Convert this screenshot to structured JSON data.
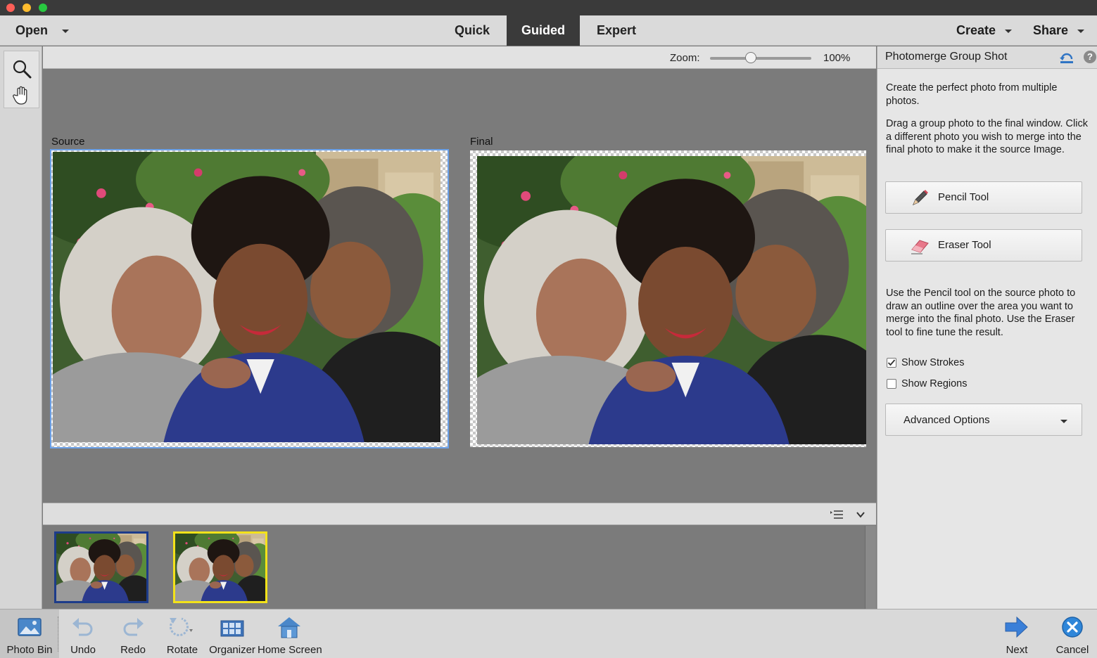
{
  "menubar": {
    "open_label": "Open",
    "modes": [
      "Quick",
      "Guided",
      "Expert"
    ],
    "active_mode": "Guided",
    "create_label": "Create",
    "share_label": "Share"
  },
  "toolbox": {
    "tools": [
      "zoom-tool",
      "hand-tool"
    ]
  },
  "options": {
    "zoom_label": "Zoom:",
    "zoom_value": "100%",
    "zoom_slider_fraction": 0.4
  },
  "canvas": {
    "source_label": "Source",
    "final_label": "Final"
  },
  "photo_bin": {
    "thumbnails": [
      "source-thumbnail",
      "final-thumbnail"
    ],
    "selected_index": 1
  },
  "panel": {
    "title": "Photomerge Group Shot",
    "intro": "Create the perfect photo from multiple photos.",
    "instructions": "Drag a group photo to the final window. Click a different photo you wish to merge into the final photo to make it the source Image.",
    "pencil_label": "Pencil Tool",
    "eraser_label": "Eraser Tool",
    "usage": "Use the Pencil tool on the source photo to draw an outline over the area you want to merge into the final photo. Use the Eraser tool to fine tune the result.",
    "show_strokes_label": "Show Strokes",
    "show_strokes_checked": true,
    "show_regions_label": "Show Regions",
    "show_regions_checked": false,
    "advanced_label": "Advanced Options",
    "help_glyph": "?"
  },
  "taskbar": {
    "photo_bin": "Photo Bin",
    "undo": "Undo",
    "redo": "Redo",
    "rotate": "Rotate",
    "organizer": "Organizer",
    "home_screen": "Home Screen",
    "next": "Next",
    "cancel": "Cancel"
  },
  "colors": {
    "accent_blue": "#3a7fd8",
    "selection_yellow": "#f3e21a",
    "cancel_blue": "#2f86d9"
  }
}
